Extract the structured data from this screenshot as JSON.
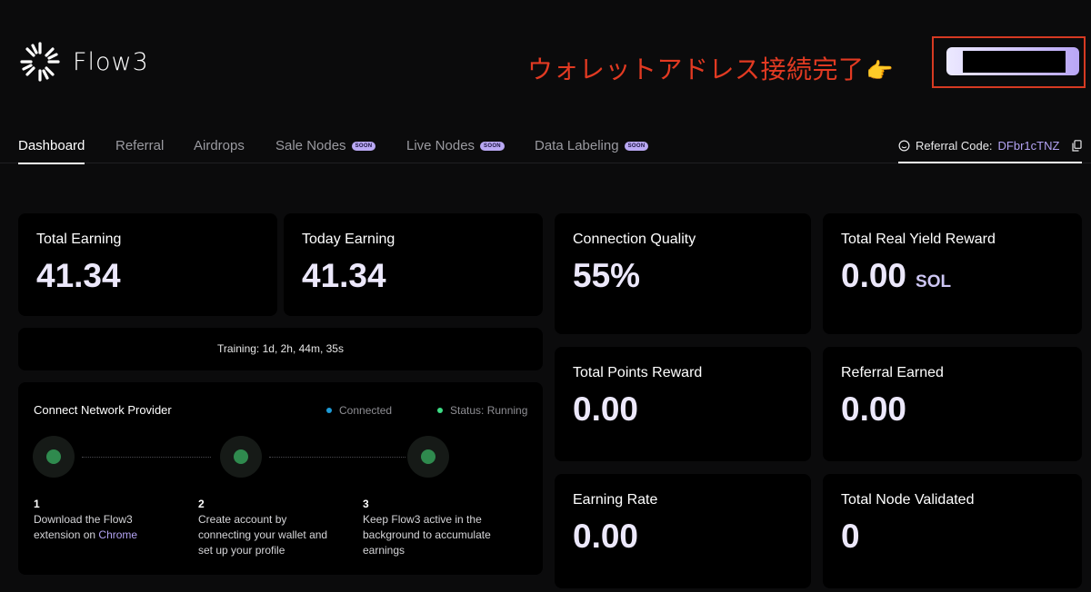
{
  "brand": {
    "name": "Flow3"
  },
  "annotation": {
    "text": "ウォレットアドレス接続完了",
    "emoji": "👉"
  },
  "tabs": [
    {
      "label": "Dashboard",
      "active": true
    },
    {
      "label": "Referral"
    },
    {
      "label": "Airdrops"
    },
    {
      "label": "Sale Nodes",
      "badge": "SOON"
    },
    {
      "label": "Live Nodes",
      "badge": "SOON"
    },
    {
      "label": "Data Labeling",
      "badge": "SOON"
    }
  ],
  "referral": {
    "label": "Referral Code:",
    "code": "DFbr1cTNZ"
  },
  "stats": {
    "total_earning": {
      "title": "Total Earning",
      "value": "41.34"
    },
    "today_earning": {
      "title": "Today Earning",
      "value": "41.34"
    },
    "connection_quality": {
      "title": "Connection Quality",
      "value": "55%"
    },
    "total_real_yield": {
      "title": "Total Real Yield Reward",
      "value": "0.00",
      "unit": "SOL"
    },
    "total_points": {
      "title": "Total Points Reward",
      "value": "0.00"
    },
    "referral_earned": {
      "title": "Referral Earned",
      "value": "0.00"
    },
    "earning_rate": {
      "title": "Earning Rate",
      "value": "0.00"
    },
    "total_node_validated": {
      "title": "Total Node Validated",
      "value": "0"
    }
  },
  "training": {
    "text": "Training: 1d, 2h, 44m, 35s"
  },
  "network": {
    "title": "Connect Network Provider",
    "legend_connected": "Connected",
    "legend_status": "Status: Running",
    "steps": [
      {
        "num": "1",
        "text": "Download the Flow3 extension on",
        "link": "Chrome"
      },
      {
        "num": "2",
        "text": "Create account by connecting your wallet and set up your profile"
      },
      {
        "num": "3",
        "text": "Keep Flow3 active in the background to accumulate earnings"
      }
    ]
  },
  "colors": {
    "accent": "#b3a3f3",
    "connected": "#1e9bd7",
    "running": "#3ddc84",
    "annotation": "#e23a22",
    "background": "#0b0b0c",
    "card": "#000000"
  },
  "icons": {
    "logo": "starburst-logo-icon",
    "smile": "smile-icon",
    "copy": "copy-icon",
    "hand": "pointing-hand-emoji"
  }
}
